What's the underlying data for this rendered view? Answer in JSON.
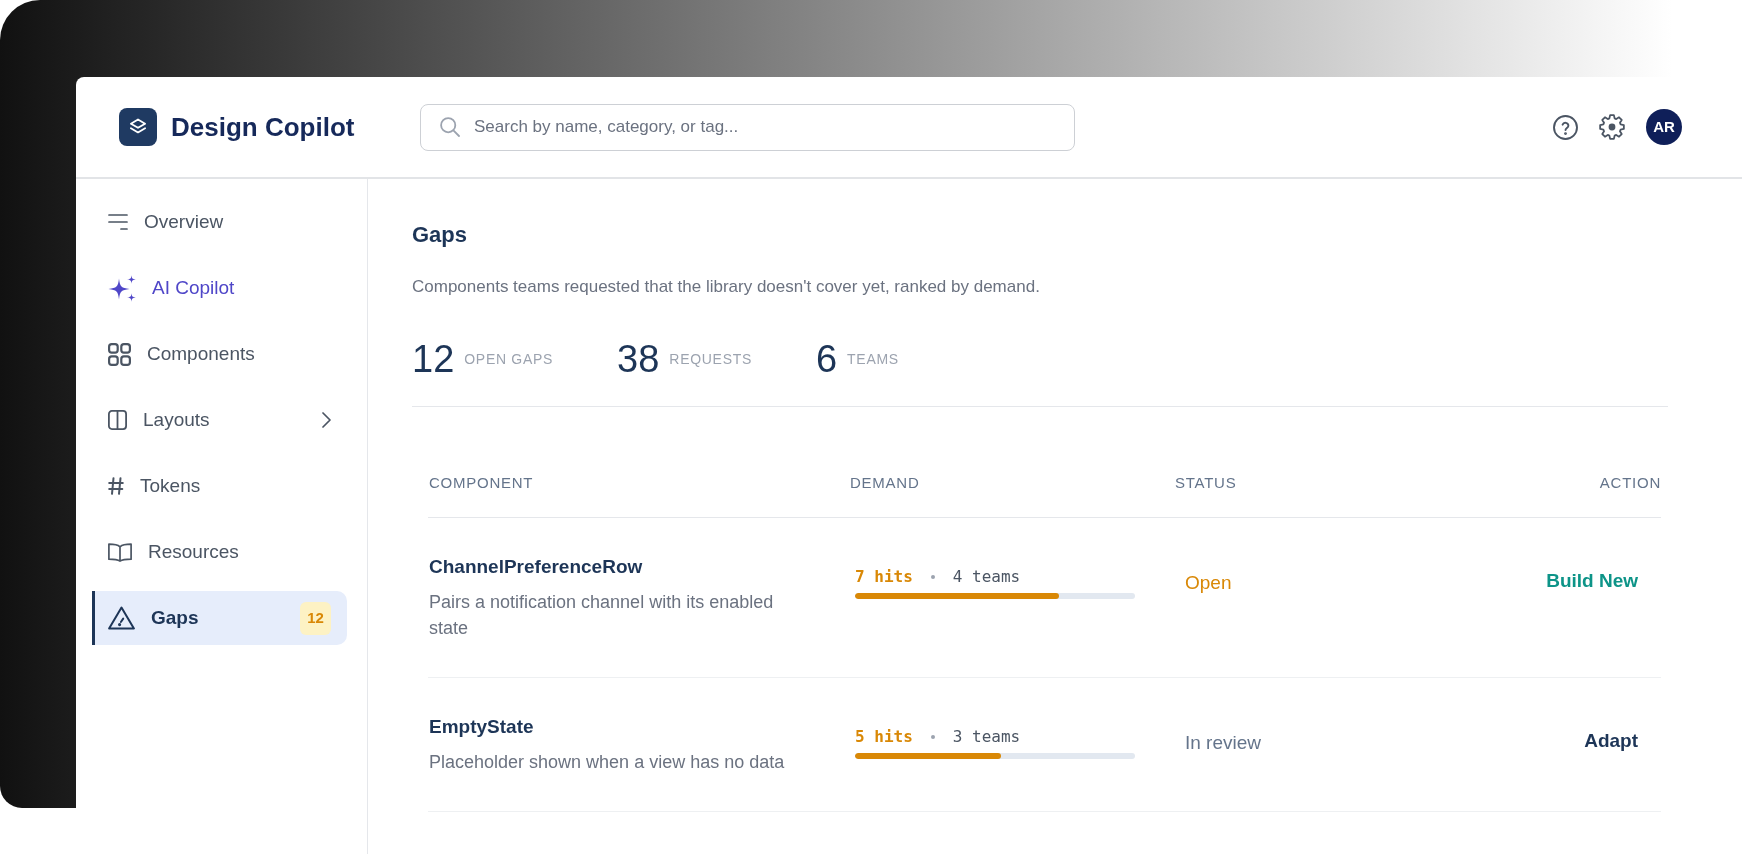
{
  "app": {
    "name": "Design Copilot"
  },
  "search": {
    "placeholder": "Search by name, category, or tag..."
  },
  "user": {
    "initials": "AR"
  },
  "sidebar": {
    "items": [
      {
        "label": "Overview",
        "kind": "page",
        "selected": false,
        "expandable": false
      },
      {
        "label": "AI Copilot",
        "kind": "ai",
        "selected": false,
        "expandable": false
      },
      {
        "label": "Components",
        "kind": "page",
        "selected": false,
        "expandable": false
      },
      {
        "label": "Layouts",
        "kind": "page",
        "selected": false,
        "expandable": true
      },
      {
        "label": "Tokens",
        "kind": "page",
        "selected": false,
        "expandable": false
      },
      {
        "label": "Resources",
        "kind": "page",
        "selected": false,
        "expandable": false
      },
      {
        "label": "Gaps",
        "kind": "page",
        "selected": true,
        "expandable": false,
        "badge": "12"
      }
    ]
  },
  "page": {
    "title": "Gaps",
    "description": "Components teams requested that the library doesn't cover yet, ranked by demand.",
    "stats": [
      {
        "value": "12",
        "label": "OPEN GAPS"
      },
      {
        "value": "38",
        "label": "REQUESTS"
      },
      {
        "value": "6",
        "label": "TEAMS"
      }
    ]
  },
  "table": {
    "columns": [
      "COMPONENT",
      "DEMAND",
      "STATUS",
      "ACTION"
    ],
    "rows": [
      {
        "name": "ChannelPreferenceRow",
        "description": "Pairs a notification channel with its enabled state",
        "hits": "7 hits",
        "teams": "4 teams",
        "level": 0.73,
        "status": {
          "label": "Open",
          "kind": "open"
        },
        "action": {
          "label": "Build New",
          "kind": "build"
        }
      },
      {
        "name": "EmptyState",
        "description": "Placeholder shown when a view has no data",
        "hits": "5 hits",
        "teams": "3 teams",
        "level": 0.52,
        "status": {
          "label": "In review",
          "kind": "review"
        },
        "action": {
          "label": "Adapt",
          "kind": "adapt"
        }
      }
    ]
  }
}
